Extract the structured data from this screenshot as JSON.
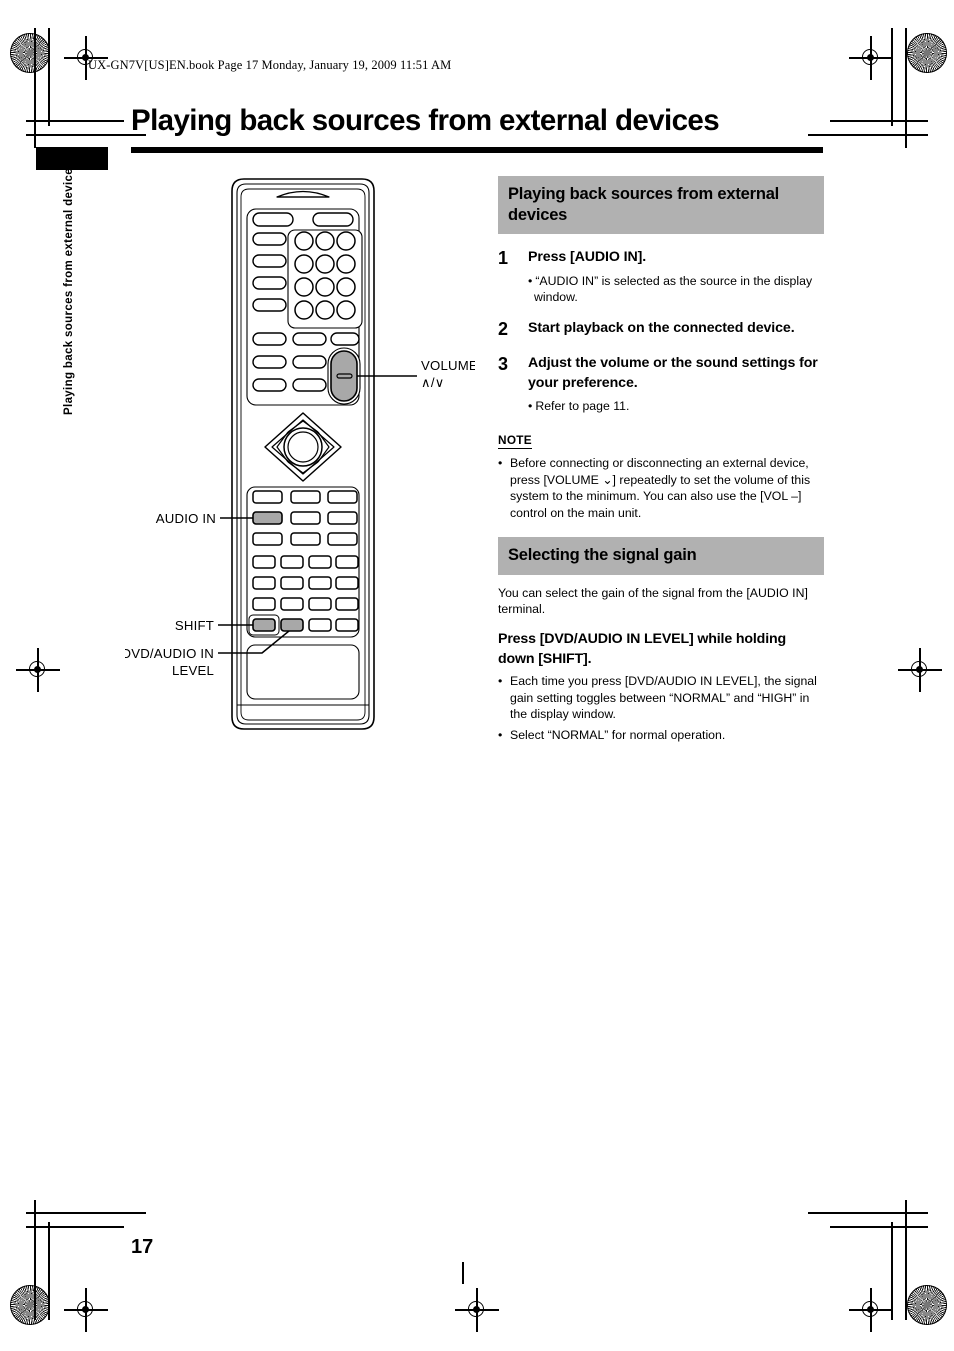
{
  "print": {
    "file_header": "UX-GN7V[US]EN.book  Page 17  Monday, January 19, 2009  11:51 AM"
  },
  "page": {
    "title": "Playing back sources from external devices",
    "number": "17",
    "side_tab_label": "Playing back sources from external devices"
  },
  "main": {
    "section1": {
      "heading": "Playing back sources from external devices",
      "steps": [
        {
          "num": "1",
          "head": "Press [AUDIO IN].",
          "bullets": [
            "“AUDIO IN” is selected as the source in the display window."
          ]
        },
        {
          "num": "2",
          "head": "Start playback on the connected device.",
          "bullets": []
        },
        {
          "num": "3",
          "head": "Adjust the volume or the sound settings for your preference.",
          "bullets": [
            "Refer to page 11."
          ]
        }
      ],
      "note_label": "NOTE",
      "note_bullet": "•",
      "notes": [
        "Before connecting or disconnecting an external device, press [VOLUME ⌄] repeatedly to set the volume of this system to the minimum. You can also use the [VOL –] control on the main unit."
      ]
    },
    "section2": {
      "heading": "Selecting the signal gain",
      "intro": "You can select the gain of the signal from the [AUDIO IN] terminal.",
      "bold_instruction": "Press [DVD/AUDIO IN LEVEL] while holding down [SHIFT].",
      "bullet": "•",
      "bullets": [
        "Each time you press [DVD/AUDIO IN LEVEL], the signal gain setting toggles between “NORMAL” and “HIGH” in the display window.",
        "Select “NORMAL” for normal operation."
      ]
    }
  },
  "figure": {
    "name": "remote-control-diagram",
    "callouts": {
      "volume": "VOLUME",
      "volume_sub": "∧/∨",
      "audio_in": "AUDIO IN",
      "shift": "SHIFT",
      "dvd_audio_in": "DVD/AUDIO IN",
      "dvd_audio_level": "LEVEL"
    }
  },
  "colors": {
    "heading_band": "#b1b1b1",
    "highlight_key": "#a8a8a8",
    "ink": "#000000",
    "paper": "#ffffff"
  }
}
